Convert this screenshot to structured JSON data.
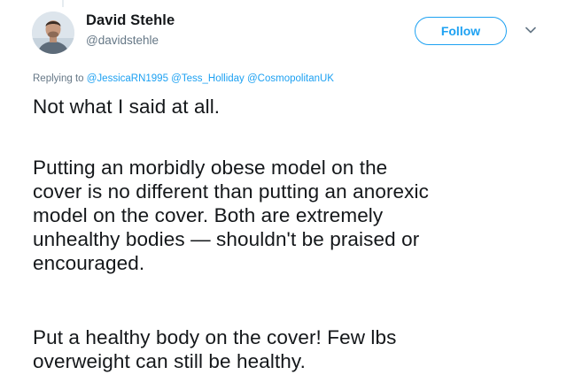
{
  "author": {
    "display_name": "David Stehle",
    "handle": "@davidstehle"
  },
  "follow_label": "Follow",
  "reply_context": {
    "prefix": "Replying to",
    "mentions": [
      "@JessicaRN1995",
      "@Tess_Holliday",
      "@CosmopolitanUK"
    ]
  },
  "tweet": {
    "lines": [
      "Not what I said at all.",
      "Putting an morbidly obese model on the",
      "cover is no different than putting an anorexic",
      "model on the cover. Both are extremely",
      "unhealthy bodies — shouldn't be praised or",
      "encouraged.",
      "Put a healthy body on the cover! Few lbs",
      "overweight can still be healthy."
    ]
  },
  "icons": {
    "more_menu": "chevron-down-icon",
    "avatar": "user-photo"
  },
  "colors": {
    "accent": "#1da1f2",
    "text": "#14171a",
    "secondary": "#657786"
  }
}
